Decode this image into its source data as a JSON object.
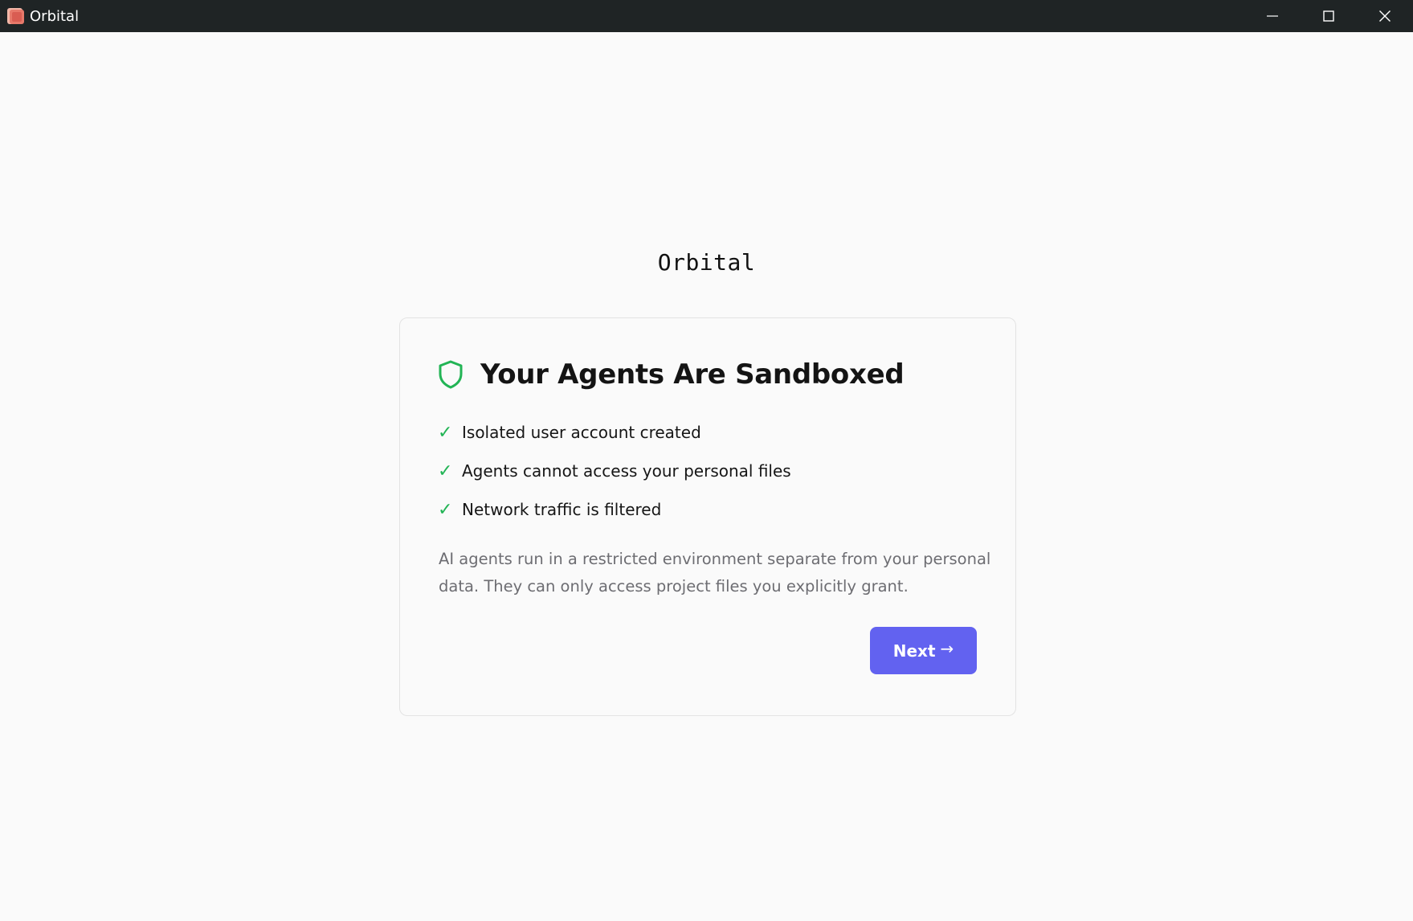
{
  "window": {
    "title": "Orbital",
    "controls": {
      "minimize_icon": "minimize-icon",
      "maximize_icon": "maximize-icon",
      "close_icon": "close-icon"
    }
  },
  "brand": {
    "name": "Orbital"
  },
  "card": {
    "icon": "shield-icon",
    "title": "Your Agents Are Sandboxed",
    "checklist": [
      {
        "mark": "✓",
        "label": "Isolated user account created"
      },
      {
        "mark": "✓",
        "label": "Agents cannot access your personal files"
      },
      {
        "mark": "✓",
        "label": "Network traffic is filtered"
      }
    ],
    "description": "AI agents run in a restricted environment separate from your personal data. They can only access project files you explicitly grant.",
    "next_button": {
      "label": "Next",
      "arrow": "→"
    }
  },
  "colors": {
    "titlebar": "#1f2425",
    "accent": "#6262f0",
    "success": "#22b455",
    "muted_text": "#6d6d72"
  }
}
